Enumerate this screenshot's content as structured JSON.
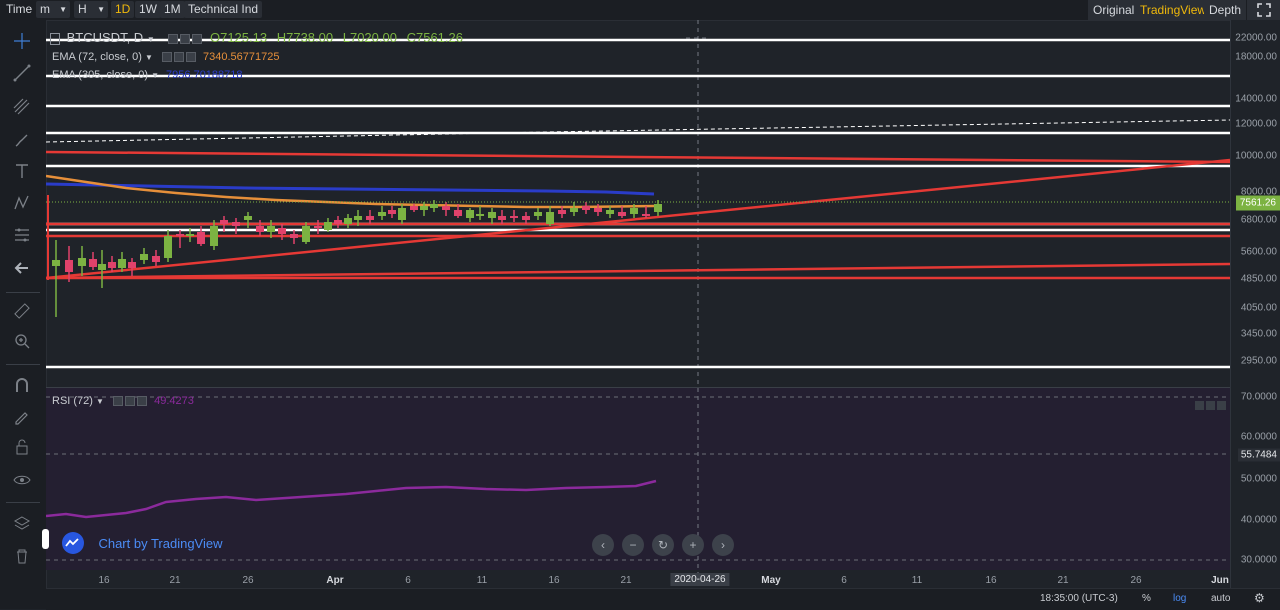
{
  "toolbar": {
    "time_label": "Time",
    "minute_select": "m",
    "hour_select": "H",
    "intervals": [
      "1D",
      "1W",
      "1M"
    ],
    "active_interval": "1D",
    "technical": "Technical Ind",
    "right_tabs": [
      "Original",
      "TradingView",
      "Depth"
    ],
    "active_right_tab": "TradingView"
  },
  "legend": {
    "symbol": "BTCUSDT, D",
    "open": "O7125.13",
    "high": "H7738.00",
    "low": "L7020.00",
    "close": "C7561.26",
    "ema72_label": "EMA (72, close, 0)",
    "ema72_value": "7340.56771725",
    "ema305_label": "EMA (305, close, 0)",
    "ema305_value": "7956.70188718",
    "rsi_label": "RSI (72)",
    "rsi_value": "49.4273"
  },
  "price_axis": [
    "22000.00",
    "18000.00",
    "14000.00",
    "12000.00",
    "10000.00",
    "8000.00",
    "6800.00",
    "5600.00",
    "4850.00",
    "4050.00",
    "3450.00",
    "2950.00"
  ],
  "current_price": "7561.26",
  "rsi_axis": [
    "70.0000",
    "60.0000",
    "50.0000",
    "40.0000",
    "30.0000"
  ],
  "rsi_current": "55.7484",
  "time_axis": [
    "16",
    "21",
    "26",
    "Apr",
    "6",
    "11",
    "16",
    "21",
    "May",
    "6",
    "11",
    "16",
    "21",
    "26",
    "Jun"
  ],
  "crosshair_date": "2020-04-26",
  "watermark": "Chart by TradingView",
  "bottombar": {
    "time": "18:35:00 (UTC-3)",
    "percent": "%",
    "log": "log",
    "auto": "auto"
  },
  "colors": {
    "up": "#7cb342",
    "down": "#e0426b",
    "ema72": "#e68f3a",
    "ema305": "#2a3cc9",
    "rsi": "#8b2a9c",
    "accent": "#f0b90b",
    "trend_red": "#e53935",
    "level_white": "#ffffff"
  },
  "icons": [
    "crosshair-icon",
    "trendline-icon",
    "fib-icon",
    "brush-icon",
    "text-icon",
    "pattern-icon",
    "measure-icon",
    "back-icon",
    "ruler-icon",
    "zoom-icon",
    "magnet-icon",
    "lock-draw-icon",
    "lock-icon",
    "eye-icon",
    "layers-icon",
    "trash-icon"
  ]
}
